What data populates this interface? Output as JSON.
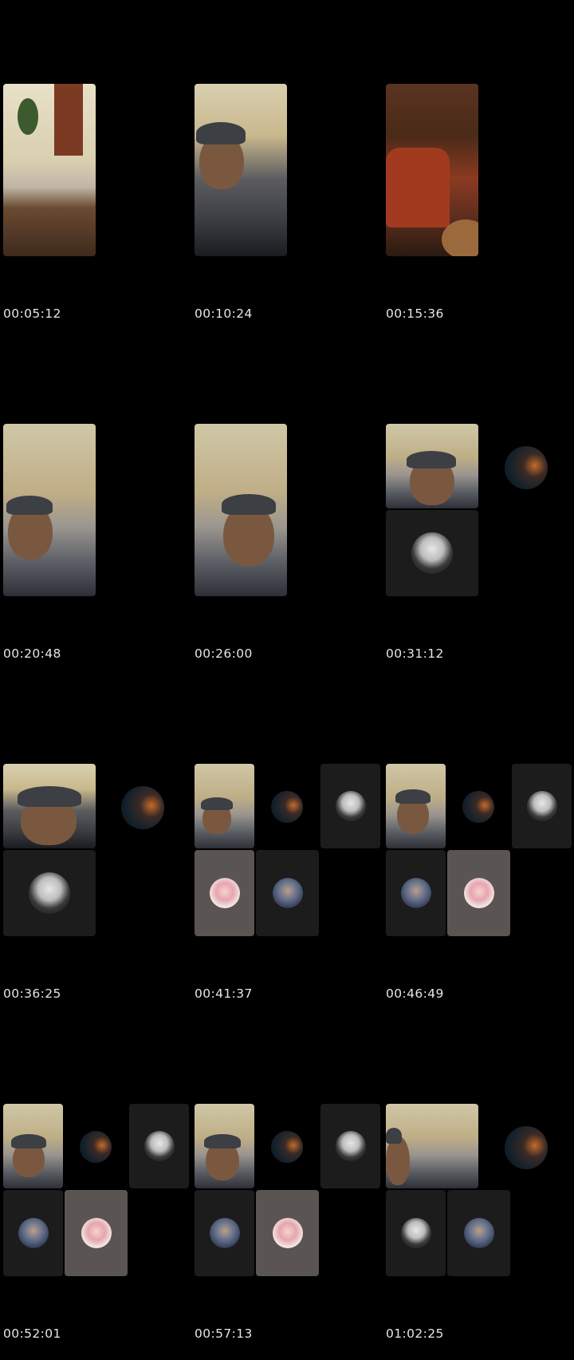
{
  "timestamps": [
    "00:05:12",
    "00:10:24",
    "00:15:36",
    "00:20:48",
    "00:26:00",
    "00:31:12",
    "00:36:25",
    "00:41:37",
    "00:46:49",
    "00:52:01",
    "00:57:13",
    "01:02:25"
  ],
  "tile_labels": {
    "camera_room": "room-camera-view",
    "camera_person": "participant-camera-view",
    "camera_library": "library-background-view"
  },
  "icons": {
    "suit_avatar": "participant-suit-avatar",
    "night_avatar": "participant-night-avatar",
    "pink_avatar": "participant-pink-avatar",
    "blue_avatar": "participant-blue-avatar"
  }
}
